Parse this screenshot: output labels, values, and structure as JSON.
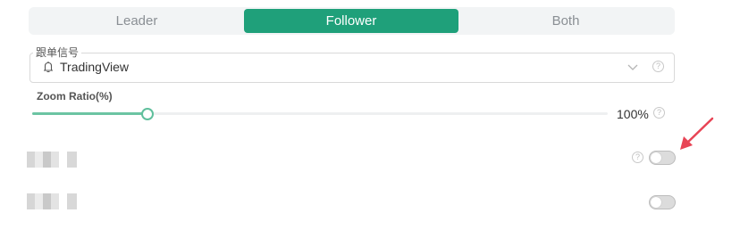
{
  "run_mode": {
    "options": [
      {
        "label": "Leader",
        "active": false
      },
      {
        "label": "Follower",
        "active": true
      },
      {
        "label": "Both",
        "active": false
      }
    ]
  },
  "signal": {
    "legend": "跟单信号",
    "value": "TradingView",
    "icon": "tradingview-bell-icon"
  },
  "zoom": {
    "label": "Zoom Ratio(%)",
    "value_text": "100%",
    "fraction": 0.2
  },
  "settings": [
    {
      "name": "setting-toggle-1",
      "enabled": false,
      "help": true
    },
    {
      "name": "setting-toggle-2",
      "enabled": false,
      "help": false
    }
  ],
  "help_glyph": "?",
  "colors": {
    "accent": "#1fa07a",
    "slider": "#6cc4a3",
    "annotation_arrow": "#e84455"
  }
}
